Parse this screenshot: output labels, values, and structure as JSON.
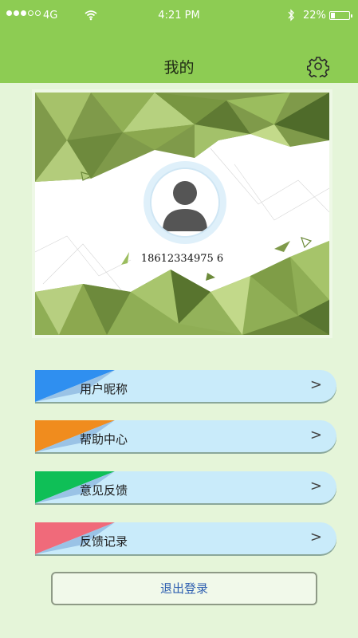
{
  "status_bar": {
    "carrier": "4G",
    "time": "4:21 PM",
    "battery": "22%",
    "battery_level": 0.22
  },
  "header": {
    "title": "我的",
    "settings_icon": "gear-icon"
  },
  "profile": {
    "phone": "18612334975 6"
  },
  "menu": [
    {
      "label": "用户昵称",
      "accent": "#2f8ff0",
      "icon": "chevron-right-icon"
    },
    {
      "label": "帮助中心",
      "accent": "#f08c1e",
      "icon": "chevron-right-icon"
    },
    {
      "label": "意见反馈",
      "accent": "#0fbf57",
      "icon": "chevron-right-icon"
    },
    {
      "label": "反馈记录",
      "accent": "#f06a7a",
      "icon": "chevron-right-icon"
    }
  ],
  "logout": {
    "label": "退出登录"
  },
  "colors": {
    "header_bg": "#8dcc53",
    "page_bg": "#e5f5d9",
    "menu_bg": "#c9ebfa"
  }
}
